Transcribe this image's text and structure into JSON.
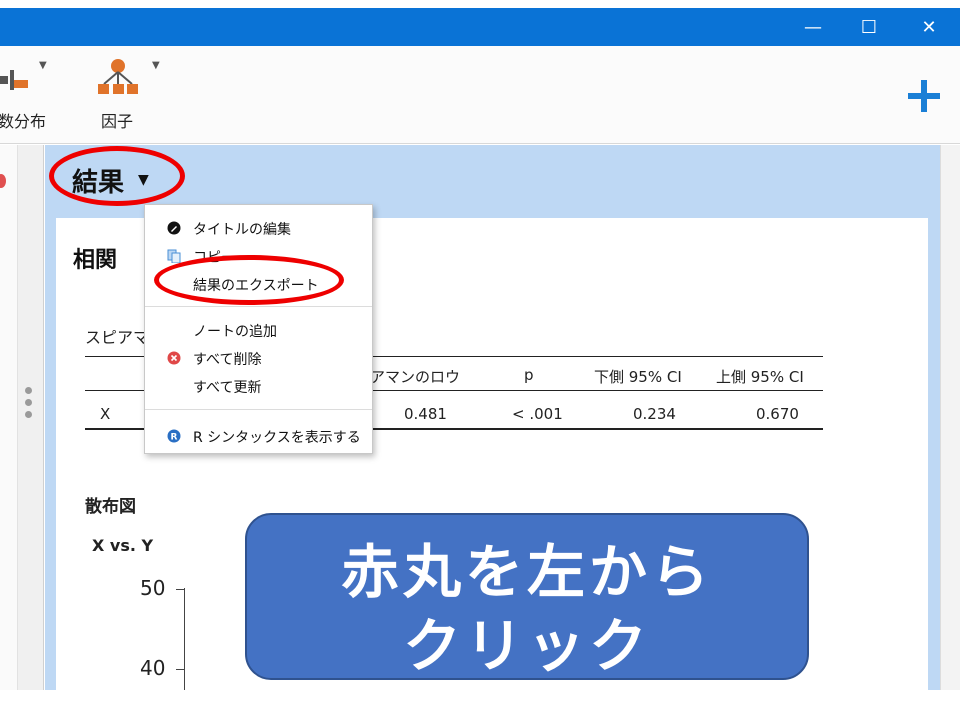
{
  "window": {
    "minimize": "—",
    "maximize": "☐",
    "close": "✕"
  },
  "ribbon": {
    "items": [
      {
        "label": "数分布",
        "icon": "histogram-icon"
      },
      {
        "label": "因子",
        "icon": "factor-icon"
      }
    ],
    "add_icon": "plus-icon",
    "accent": "#0a73d6"
  },
  "results": {
    "heading": "結果",
    "caret": "▼",
    "bg_color": "#bed8f4",
    "section_title": "相関",
    "table_caption": "スピアマ",
    "table": {
      "headers": [
        "アマンのロウ",
        "p",
        "下側 95% CI",
        "上側 95% CI"
      ],
      "rows": [
        {
          "var": "X",
          "values": [
            "0.481",
            "< .001",
            "0.234",
            "0.670"
          ]
        }
      ]
    },
    "scatter_title": "散布図",
    "plot_title": "X vs. Y",
    "y_ticks": [
      "50",
      "40"
    ]
  },
  "context_menu": {
    "items": [
      {
        "label": "タイトルの編集",
        "icon": "edit-icon"
      },
      {
        "label": "コピー",
        "icon": "copy-icon"
      },
      {
        "label": "結果のエクスポート",
        "icon": ""
      },
      {
        "label": "ノートの追加",
        "icon": ""
      },
      {
        "label": "すべて削除",
        "icon": "delete-icon"
      },
      {
        "label": "すべて更新",
        "icon": ""
      },
      {
        "label": "R シンタックスを表示する",
        "icon": "r-icon"
      }
    ]
  },
  "annotation": {
    "line1": "赤丸を左から",
    "line2": "クリック",
    "ring_color": "#ee0000",
    "box_color": "#4472c4"
  }
}
